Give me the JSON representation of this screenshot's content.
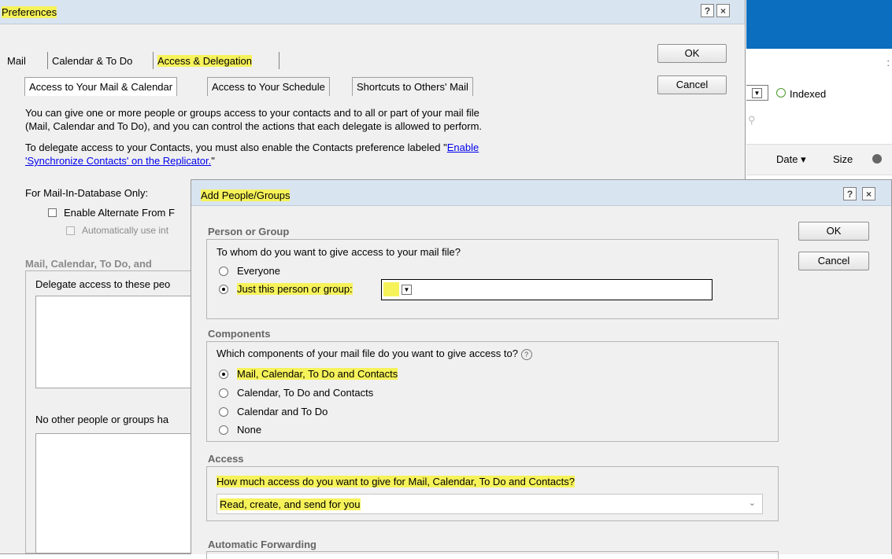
{
  "background_app": {
    "indexed_label": "Indexed",
    "col_date": "Date",
    "col_size": "Size",
    "colors": {
      "bar": "#0b6ebf",
      "indexed_dot": "#7ac943"
    }
  },
  "preferences": {
    "title": "Preferences",
    "help_button": "?",
    "close_button": "×",
    "tabs": [
      "Mail",
      "Calendar & To Do",
      "Access & Delegation"
    ],
    "subtabs": [
      "Access to Your Mail & Calendar",
      "Access to Your Schedule",
      "Shortcuts to Others' Mail"
    ],
    "ok_label": "OK",
    "cancel_label": "Cancel",
    "intro_line1": "You can give one or more people or groups access to your contacts and to all or part of your mail file",
    "intro_line2": "(Mail, Calendar and To Do), and you can control the actions that each delegate is allowed to perform.",
    "contacts_text": "To delegate access to your Contacts, you must also enable the Contacts preference labeled \"",
    "contacts_link1": "Enable",
    "contacts_link2": "'Synchronize Contacts' on the Replicator.",
    "contacts_text_end": "\"",
    "mail_in_label": "For Mail-In-Database Only:",
    "enable_alt_from": "Enable Alternate From F",
    "auto_use": "Automatically use int",
    "section_label": "Mail, Calendar, To Do, and",
    "delegate_label": "Delegate access to these peo",
    "no_other_label": "No other people or groups ha"
  },
  "add_people": {
    "title": "Add People/Groups",
    "help_button": "?",
    "close_button": "×",
    "ok_label": "OK",
    "cancel_label": "Cancel",
    "person_section": "Person or Group",
    "person_question": "To whom do you want to give access to your mail file?",
    "opt_everyone": "Everyone",
    "opt_just_person": "Just this person or group:",
    "components_section": "Components",
    "components_question": "Which components of your mail file do you want to give access to?",
    "component_options": [
      "Mail, Calendar, To Do and Contacts",
      "Calendar, To Do and Contacts",
      "Calendar and To Do",
      "None"
    ],
    "access_section": "Access",
    "access_question": "How much access do you want to give for Mail, Calendar, To Do and Contacts?",
    "access_value": "Read, create, and send for you",
    "forwarding_section": "Automatic Forwarding"
  }
}
